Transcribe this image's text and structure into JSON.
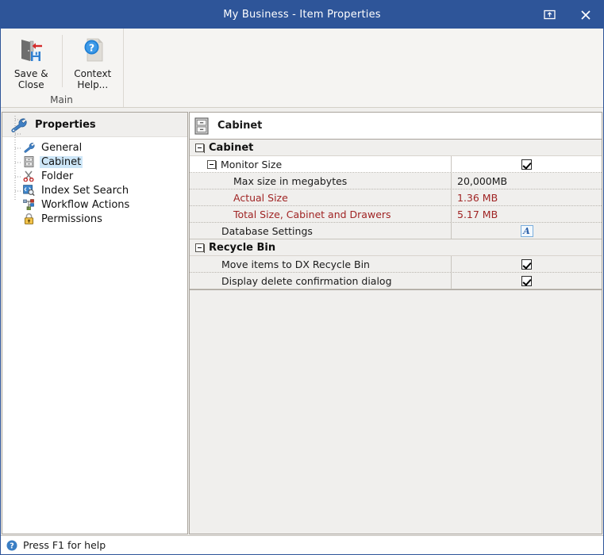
{
  "window": {
    "title": "My Business - Item Properties",
    "restore_icon": "restore-window-icon",
    "close_icon": "close-icon",
    "accent_color": "#2e5599"
  },
  "ribbon": {
    "group_label": "Main",
    "buttons": [
      {
        "id": "save-close",
        "line1": "Save &",
        "line2": "Close",
        "accel": "S",
        "icon": "save-and-close-icon"
      },
      {
        "id": "context-help",
        "line1": "Context",
        "line2": "Help...",
        "accel": "C",
        "icon": "context-help-icon"
      }
    ]
  },
  "sidebar": {
    "header": {
      "label": "Properties",
      "icon": "wrench-icon"
    },
    "items": [
      {
        "label": "General",
        "icon": "wrench-icon",
        "selected": false
      },
      {
        "label": "Cabinet",
        "icon": "cabinet-icon",
        "selected": true
      },
      {
        "label": "Folder",
        "icon": "scissors-icon",
        "selected": false
      },
      {
        "label": "Index Set Search",
        "icon": "index-search-icon",
        "selected": false
      },
      {
        "label": "Workflow Actions",
        "icon": "workflow-icon",
        "selected": false
      },
      {
        "label": "Permissions",
        "icon": "padlock-icon",
        "selected": false
      }
    ]
  },
  "main": {
    "header": {
      "label": "Cabinet",
      "icon": "cabinet-icon"
    },
    "categories": [
      {
        "label": "Cabinet",
        "expanded": true,
        "rows": [
          {
            "name": "Monitor Size",
            "indent": 1,
            "expander": true,
            "value_type": "checkbox",
            "checked": true,
            "value": "",
            "red": false,
            "highlight": true
          },
          {
            "name": "Max size in megabytes",
            "indent": 2,
            "expander": false,
            "value_type": "text",
            "value": "20,000MB",
            "red": false,
            "highlight": false
          },
          {
            "name": "Actual Size",
            "indent": 2,
            "expander": false,
            "value_type": "text",
            "value": "1.36 MB",
            "red": true,
            "highlight": false
          },
          {
            "name": "Total Size, Cabinet and Drawers",
            "indent": 2,
            "expander": false,
            "value_type": "text",
            "value": "5.17 MB",
            "red": true,
            "highlight": false
          },
          {
            "name": "Database Settings",
            "indent": 1,
            "expander": false,
            "value_type": "editor",
            "value": "A",
            "red": false,
            "highlight": false
          }
        ]
      },
      {
        "label": "Recycle Bin",
        "expanded": true,
        "rows": [
          {
            "name": "Move items to DX Recycle Bin",
            "indent": 1,
            "expander": false,
            "value_type": "checkbox",
            "checked": true,
            "value": "",
            "red": false,
            "highlight": false
          },
          {
            "name": "Display delete confirmation dialog",
            "indent": 1,
            "expander": false,
            "value_type": "checkbox",
            "checked": true,
            "value": "",
            "red": false,
            "highlight": false
          }
        ]
      }
    ]
  },
  "statusbar": {
    "icon": "help-circle-icon",
    "text": "Press F1 for help"
  }
}
